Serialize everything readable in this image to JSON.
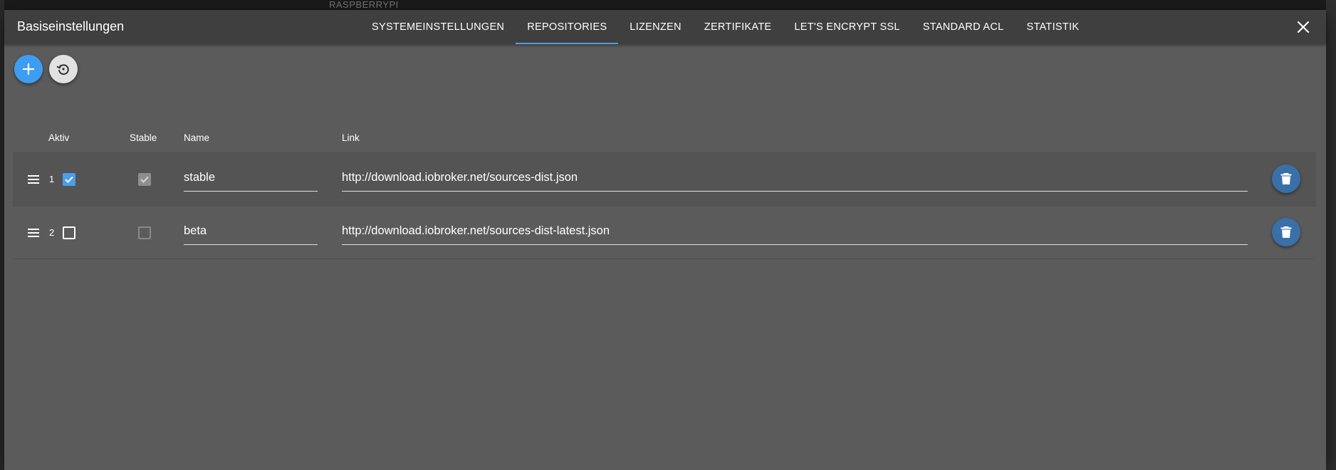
{
  "background": {
    "host_label": "RASPBERRYPI"
  },
  "dialog": {
    "title": "Basiseinstellungen",
    "tabs": [
      {
        "label": "Systemeinstellungen",
        "active": false
      },
      {
        "label": "Repositories",
        "active": true
      },
      {
        "label": "Lizenzen",
        "active": false
      },
      {
        "label": "Zertifikate",
        "active": false
      },
      {
        "label": "Let's Encrypt SSL",
        "active": false
      },
      {
        "label": "Standard ACL",
        "active": false
      },
      {
        "label": "Statistik",
        "active": false
      }
    ],
    "close_icon": "close-icon"
  },
  "actions": {
    "add_icon": "plus-icon",
    "restore_icon": "restore-icon"
  },
  "table": {
    "columns": {
      "aktiv": "Aktiv",
      "stable": "Stable",
      "name": "Name",
      "link": "Link"
    },
    "rows": [
      {
        "index": "1",
        "aktiv": true,
        "stable": true,
        "name": "stable",
        "link": "http://download.iobroker.net/sources-dist.json"
      },
      {
        "index": "2",
        "aktiv": false,
        "stable": false,
        "name": "beta",
        "link": "http://download.iobroker.net/sources-dist-latest.json"
      }
    ]
  },
  "colors": {
    "accent": "#4a9fe6",
    "dialog_bg": "#5b5b5b",
    "header_bg": "#3f3f3f",
    "delete_button": "#3a6fa8"
  }
}
